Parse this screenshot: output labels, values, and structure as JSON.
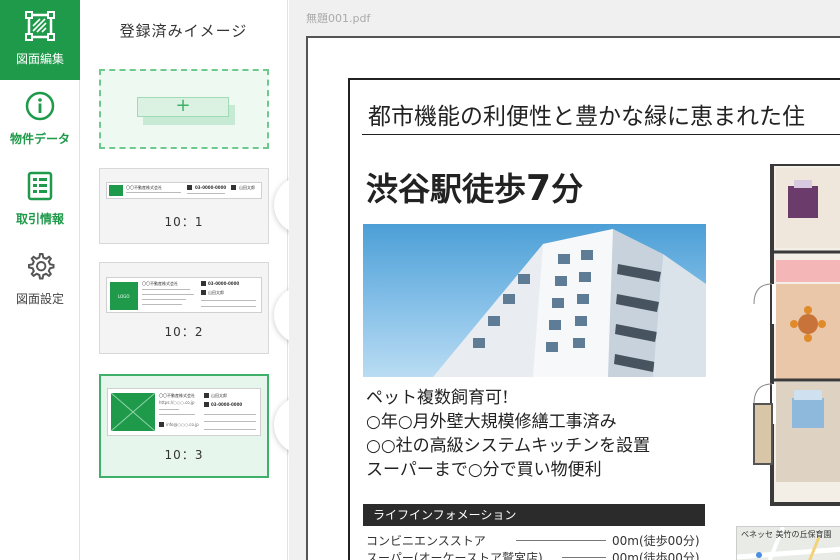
{
  "sidebar": {
    "items": [
      {
        "label": "図面編集",
        "icon": "floorplan-edit-icon",
        "active": true
      },
      {
        "label": "物件データ",
        "icon": "info-icon",
        "active": false
      },
      {
        "label": "取引情報",
        "icon": "list-document-icon",
        "active": false
      },
      {
        "label": "図面設定",
        "icon": "gear-icon",
        "active": false
      }
    ]
  },
  "panel": {
    "title": "登録済みイメージ",
    "add_symbol": "+",
    "templates": [
      {
        "ratio": "10：1",
        "number": "1",
        "company": "〇〇不動産株式会社",
        "tel": "03-0000-0000",
        "person": "山田太郎"
      },
      {
        "ratio": "10：2",
        "number": "2",
        "company": "〇〇不動産株式会社",
        "tel": "03-0000-0000",
        "person": "山田太郎",
        "logo": "LOGO"
      },
      {
        "ratio": "10：3",
        "number": "3",
        "company": "〇〇不動産株式会社",
        "tel": "03-0000-0000",
        "person": "山田太郎",
        "url": "https://○○○.co.jp",
        "email": "info@○○○.co.jp",
        "selected": true
      }
    ]
  },
  "canvas": {
    "filename": "無題001.pdf",
    "headline": "都市機能の利便性と豊かな緑に恵まれた住",
    "station_prefix": "渋谷駅徒歩",
    "station_minutes": "7",
    "station_suffix": "分",
    "features": [
      "ペット複数飼育可!",
      "○年○月外壁大規模修繕工事済み",
      "○○社の高級システムキッチンを設置",
      "スーパーまで○分で買い物便利"
    ],
    "lifeline_title": "ライフインフォメーション",
    "distances": [
      {
        "name": "コンビニエンスストア",
        "value": "00m(徒歩00分)"
      },
      {
        "name": "スーパー(オーケーストア鷲宮店)",
        "value": "00m(徒歩00分)"
      }
    ],
    "map_label": "ベネッセ 美竹の丘保育園"
  },
  "colors": {
    "brand_green": "#1f9a4a",
    "light_green": "#e7f6ec"
  }
}
